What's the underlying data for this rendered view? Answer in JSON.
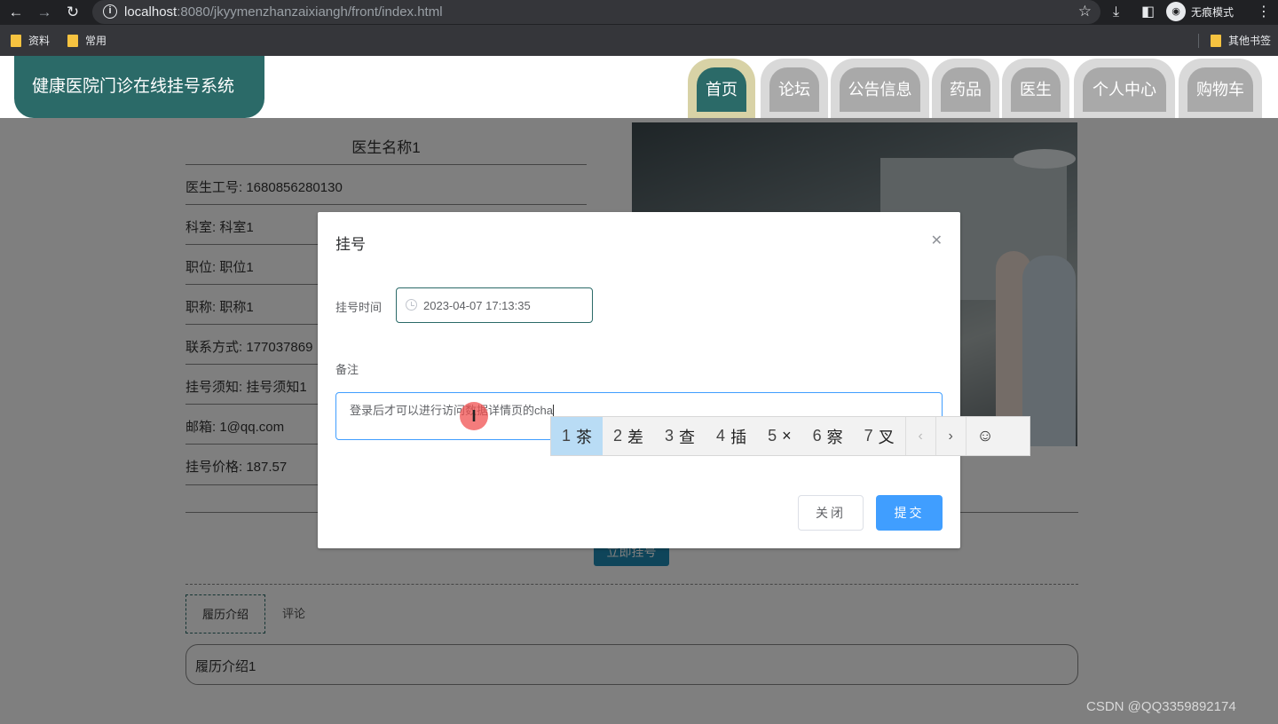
{
  "browser": {
    "url_host": "localhost",
    "url_path": ":8080/jkyymenzhanzaixiangh/front/index.html",
    "incognito_label": "无痕模式",
    "bookmarks": [
      "资料",
      "常用"
    ],
    "other_bookmarks": "其他书签"
  },
  "site": {
    "title": "健康医院门诊在线挂号系统",
    "nav": [
      "首页",
      "论坛",
      "公告信息",
      "药品",
      "医生",
      "个人中心",
      "购物车"
    ],
    "active_nav": "首页"
  },
  "doctor": {
    "name": "医生名称1",
    "fields": [
      "医生工号: 1680856280130",
      "科室: 科室1",
      "职位: 职位1",
      "职称: 职称1",
      "联系方式: 177037869",
      "挂号须知: 挂号须知1",
      "邮箱: 1@qq.com",
      "挂号价格: 187.57"
    ],
    "book_button": "立即挂号",
    "tabs": [
      "履历介绍",
      "评论"
    ],
    "intro_text": "履历介绍1"
  },
  "modal": {
    "title": "挂号",
    "time_label": "挂号时间",
    "time_value": "2023-04-07 17:13:35",
    "remark_label": "备注",
    "remark_value": "登录后才可以进行访问数据详情页的cha",
    "close_button": "关闭",
    "submit_button": "提交"
  },
  "ime": {
    "candidates": [
      {
        "n": "1",
        "c": "茶"
      },
      {
        "n": "2",
        "c": "差"
      },
      {
        "n": "3",
        "c": "查"
      },
      {
        "n": "4",
        "c": "插"
      },
      {
        "n": "5",
        "c": "×"
      },
      {
        "n": "6",
        "c": "察"
      },
      {
        "n": "7",
        "c": "叉"
      }
    ],
    "selected_index": 0
  },
  "watermark": "CSDN @QQ3359892174"
}
